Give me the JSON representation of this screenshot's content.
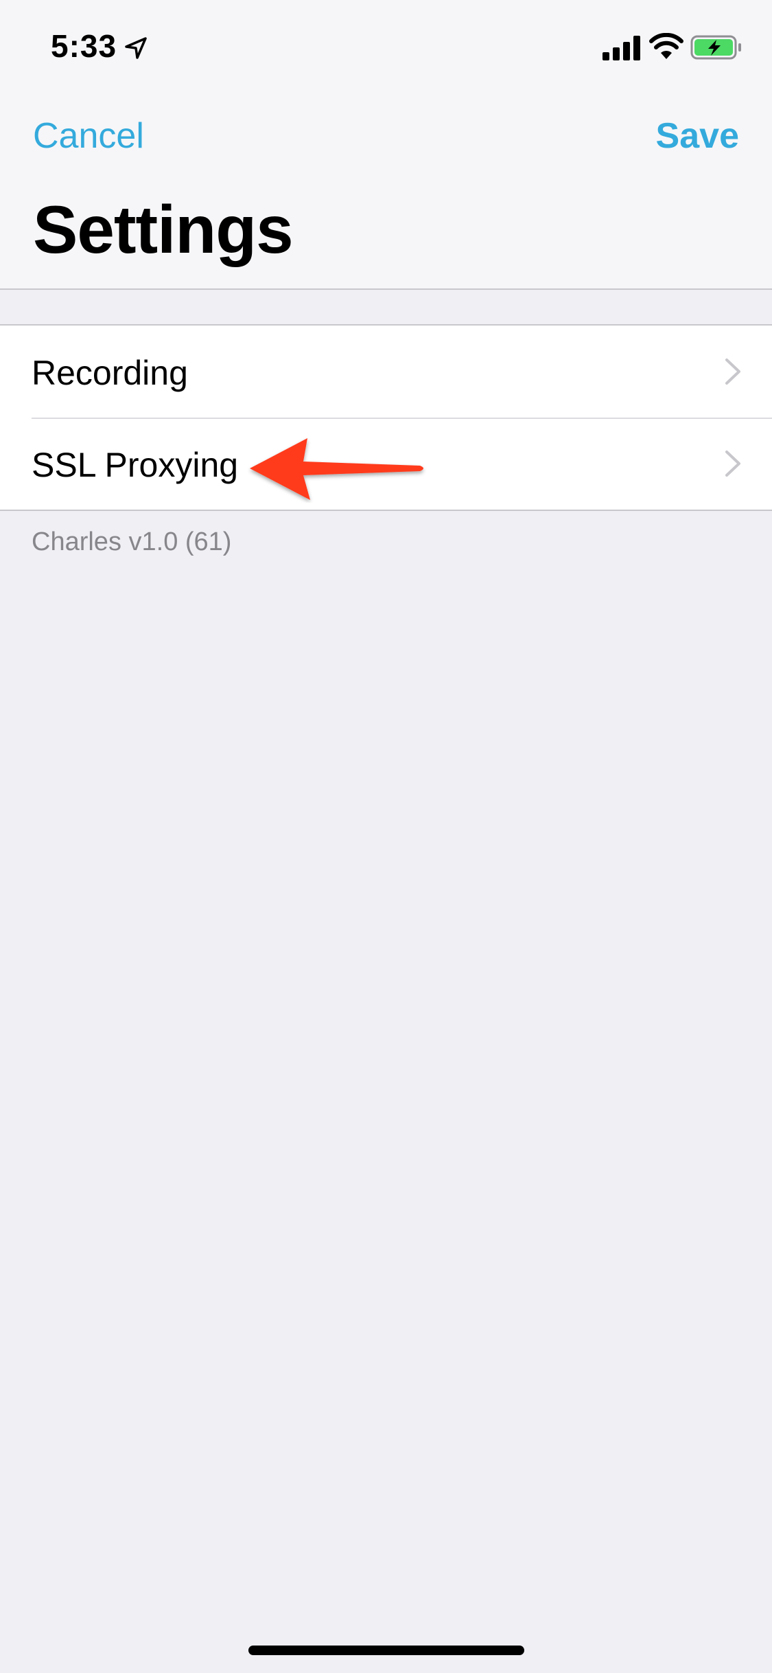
{
  "status_bar": {
    "time": "5:33",
    "icons": [
      "location-arrow-icon",
      "cellular-signal-icon",
      "wifi-icon",
      "battery-charging-icon"
    ]
  },
  "nav": {
    "cancel_label": "Cancel",
    "save_label": "Save",
    "title": "Settings"
  },
  "settings": {
    "rows": [
      {
        "label": "Recording"
      },
      {
        "label": "SSL Proxying"
      }
    ],
    "footer": "Charles v1.0 (61)"
  },
  "colors": {
    "accent": "#34aadc",
    "background": "#efeff4",
    "annotation_arrow": "#ff3b1f",
    "battery_fill": "#4cd964"
  }
}
